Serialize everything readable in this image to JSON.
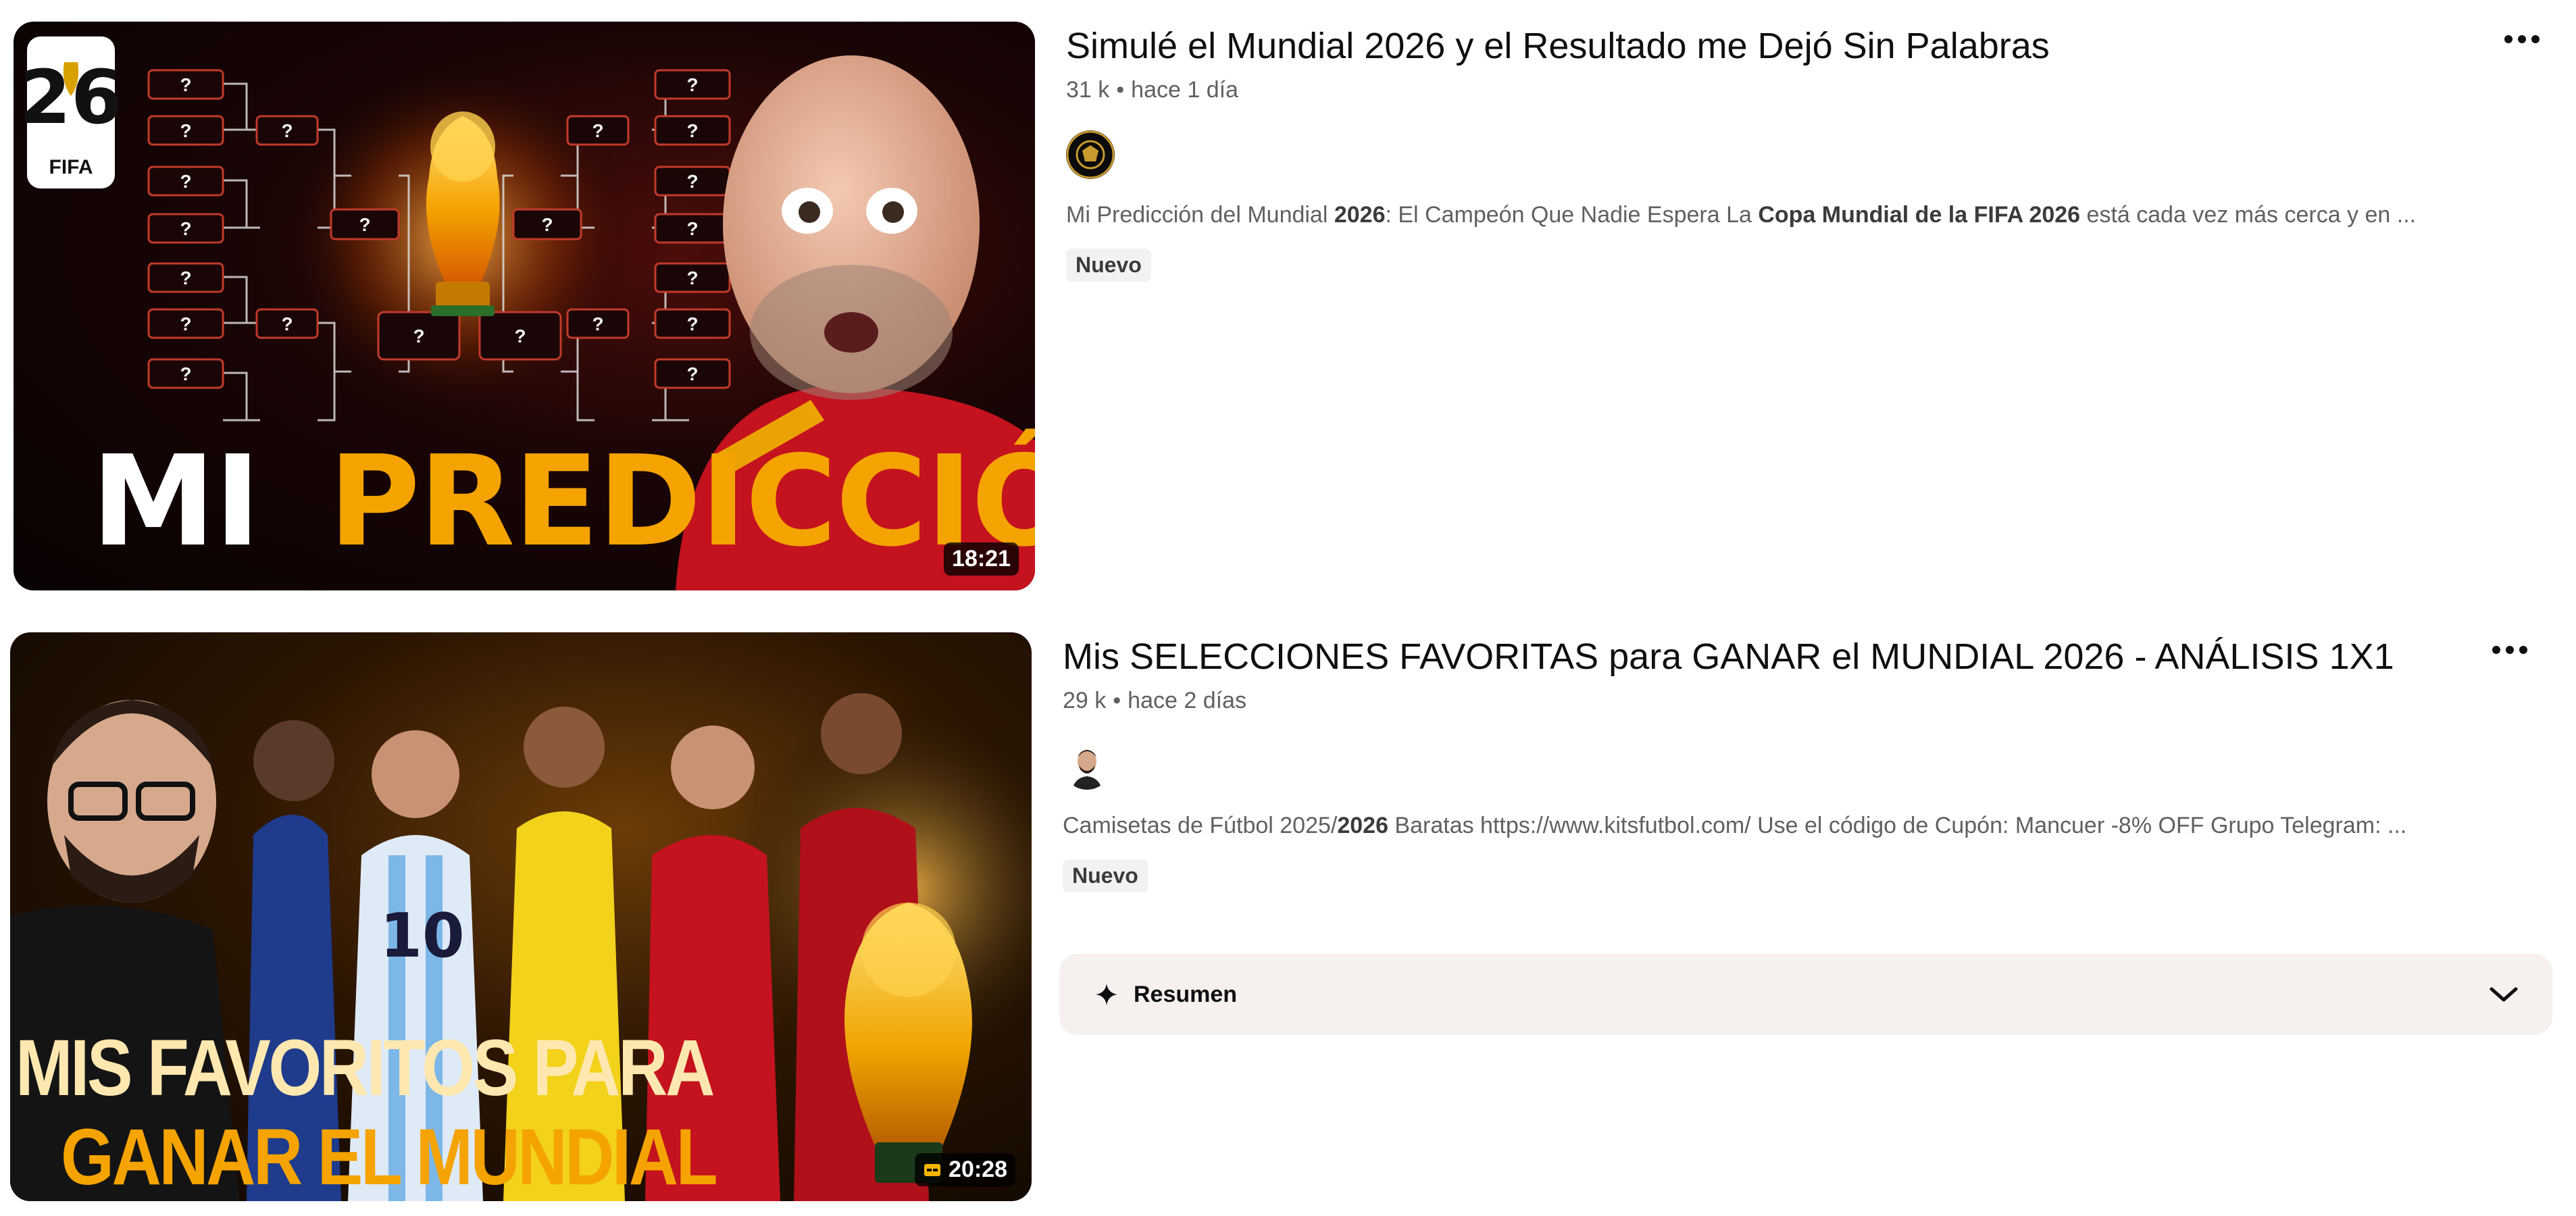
{
  "results": [
    {
      "title": "Simulé el Mundial 2026 y el Resultado me Dejó Sin Palabras",
      "views": "31 k",
      "age": "hace 1 día",
      "description_parts": [
        "Mi Predicción del Mundial ",
        "2026",
        ": El Campeón Que Nadie Espera La ",
        "Copa Mundial de la FIFA 2026",
        " está cada vez más cerca y en ..."
      ],
      "badge": "Nuevo",
      "duration": "18:21",
      "thumbnail": {
        "headline_white": "MI",
        "headline_gold": "PREDICCIÓN",
        "logo_number": "26",
        "logo_text": "FIFA",
        "bracket_mark": "?"
      },
      "more_icon": "more-vert-icon"
    },
    {
      "title": "Mis SELECCIONES FAVORITAS para GANAR el MUNDIAL 2026 - ANÁLISIS 1X1",
      "views": "29 k",
      "age": "hace 2 días",
      "description_parts": [
        "Camisetas de Fútbol 2025/",
        "2026",
        " Baratas https://www.kitsfutbol.com/ Use el código de Cupón: Mancuer -8% OFF Grupo Telegram: ..."
      ],
      "badge": "Nuevo",
      "duration": "20:28",
      "thumbnail": {
        "line1": "MIS FAVORITOS PARA",
        "line2": "GANAR EL MUNDIAL",
        "jersey_number": "10"
      },
      "summary_label": "Resumen",
      "more_icon": "more-vert-icon"
    }
  ],
  "separator": "•",
  "colors": {
    "gold": "#f5a300",
    "badge_bg": "#f2f2f2",
    "summary_bg": "#f6f1ef",
    "meta_text": "#606060"
  }
}
